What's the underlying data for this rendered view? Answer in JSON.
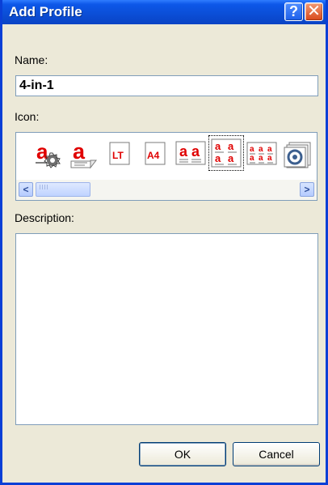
{
  "window": {
    "title": "Add Profile",
    "help_glyph": "?",
    "close_glyph": "✕"
  },
  "form": {
    "name_label": "Name:",
    "name_value": "4-in-1",
    "icon_label": "Icon:",
    "description_label": "Description:",
    "description_value": ""
  },
  "icon_picker": {
    "selected_index": 5,
    "icons": [
      {
        "name": "letter-a-gear-icon",
        "text": "a"
      },
      {
        "name": "letter-a-document-icon",
        "text": "a"
      },
      {
        "name": "lt-paper-icon",
        "text": "LT"
      },
      {
        "name": "a4-paper-icon",
        "text": "A4"
      },
      {
        "name": "two-up-pages-icon",
        "text": "aa"
      },
      {
        "name": "four-up-pages-icon",
        "text": "aaaa"
      },
      {
        "name": "six-up-pages-icon",
        "text": "aaaaaa"
      },
      {
        "name": "stacked-pages-icon",
        "text": ""
      }
    ],
    "scroll_left_glyph": "<",
    "scroll_right_glyph": ">"
  },
  "buttons": {
    "ok": "OK",
    "cancel": "Cancel"
  },
  "colors": {
    "titlebar": "#0b4fd8",
    "dialog_bg": "#ece9d8",
    "accent_red": "#e00000",
    "border_blue": "#7f9db9"
  }
}
